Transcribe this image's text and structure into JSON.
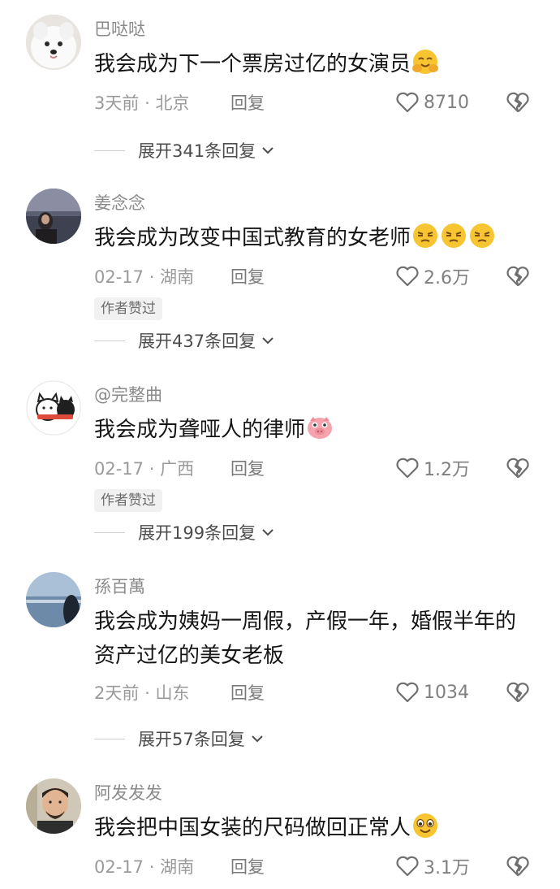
{
  "comments": [
    {
      "username": "巴哒哒",
      "text": "我会成为下一个票房过亿的女演员",
      "emoji": "hugging-face-emoji",
      "time": "3天前",
      "location": "北京",
      "reply": "回复",
      "likes": "8710",
      "author_liked": "",
      "expand": "展开341条回复"
    },
    {
      "username": "姜念念",
      "text": "我会成为改变中国式教育的女老师",
      "emoji": "unamused-face-emoji",
      "time": "02-17",
      "location": "湖南",
      "reply": "回复",
      "likes": "2.6万",
      "author_liked": "作者赞过",
      "expand": "展开437条回复"
    },
    {
      "username": "@完整曲",
      "text": "我会成为聋哑人的律师",
      "emoji": "pig-face-emoji",
      "time": "02-17",
      "location": "广西",
      "reply": "回复",
      "likes": "1.2万",
      "author_liked": "作者赞过",
      "expand": "展开199条回复"
    },
    {
      "username": "孫百萬",
      "text": "我会成为姨妈一周假，产假一年，婚假半年的资产过亿的美女老板",
      "emoji": "",
      "time": "2天前",
      "location": "山东",
      "reply": "回复",
      "likes": "1034",
      "author_liked": "",
      "expand": "展开57条回复"
    },
    {
      "username": "阿发发发",
      "text": "我会把中国女装的尺码做回正常人",
      "emoji": "smiling-face-emoji",
      "time": "02-17",
      "location": "湖南",
      "reply": "回复",
      "likes": "3.1万",
      "author_liked": "",
      "expand": ""
    }
  ],
  "meta_separator": "·",
  "icons": {
    "like": "heart-outline-icon",
    "dislike": "broken-heart-icon",
    "expand": "chevron-down-icon"
  },
  "colors": {
    "username": "#8a8a8a",
    "text": "#161616",
    "meta": "#9a9a9a",
    "badge_bg": "#f1f1f1",
    "emoji_yellow": "#f7c531",
    "pig_pink": "#f5a3ad"
  }
}
